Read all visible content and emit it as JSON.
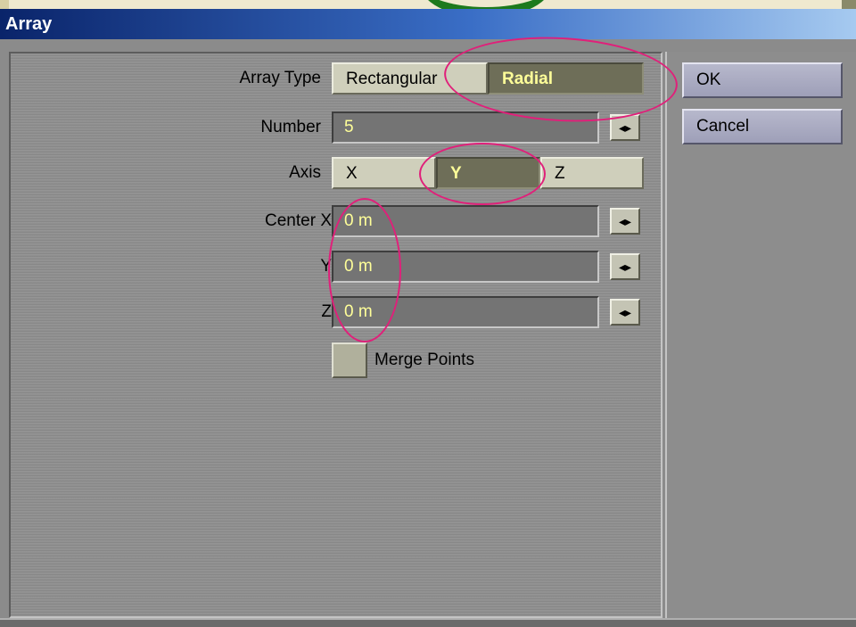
{
  "window": {
    "title": "Array"
  },
  "form": {
    "array_type": {
      "label": "Array Type",
      "options": [
        "Rectangular",
        "Radial"
      ],
      "selected": "Radial"
    },
    "number": {
      "label": "Number",
      "value": "5"
    },
    "axis": {
      "label": "Axis",
      "options": [
        "X",
        "Y",
        "Z"
      ],
      "selected": "Y"
    },
    "center_x": {
      "label": "Center X",
      "value": "0 m"
    },
    "center_y": {
      "label": "Y",
      "value": "0 m"
    },
    "center_z": {
      "label": "Z",
      "value": "0 m"
    },
    "merge_points": {
      "label": "Merge Points",
      "checked": false
    }
  },
  "buttons": {
    "ok": "OK",
    "cancel": "Cancel"
  },
  "icons": {
    "spinner": "double-arrow-icon",
    "spinner_glyph": "◂▸"
  },
  "colors": {
    "highlight_circle": "#e0207a",
    "selected_text": "#ffff99",
    "title_gradient_start": "#0a246a"
  }
}
